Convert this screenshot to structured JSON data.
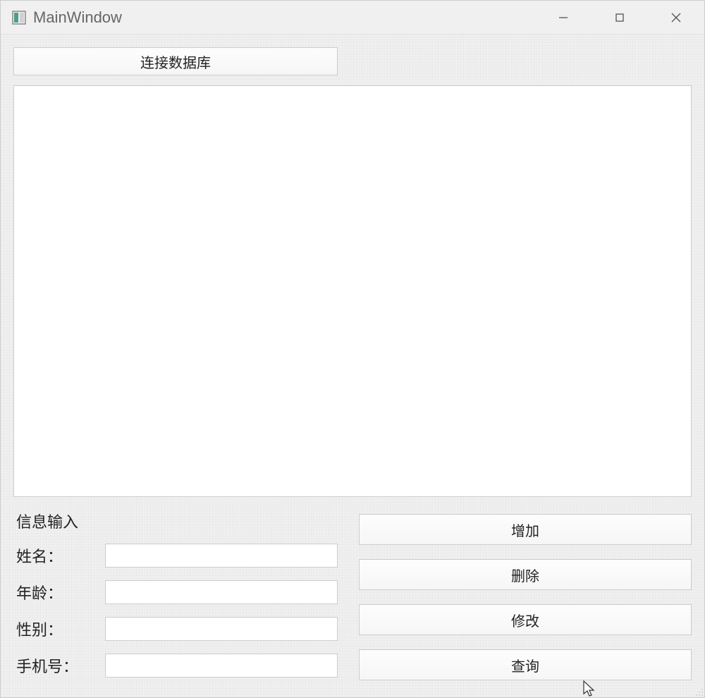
{
  "window": {
    "title": "MainWindow"
  },
  "buttons": {
    "connect": "连接数据库",
    "add": "增加",
    "delete": "删除",
    "modify": "修改",
    "query": "查询"
  },
  "form": {
    "header": "信息输入",
    "name_label": "姓名：",
    "age_label": "年龄：",
    "gender_label": "性别：",
    "phone_label": "手机号：",
    "name_value": "",
    "age_value": "",
    "gender_value": "",
    "phone_value": ""
  }
}
